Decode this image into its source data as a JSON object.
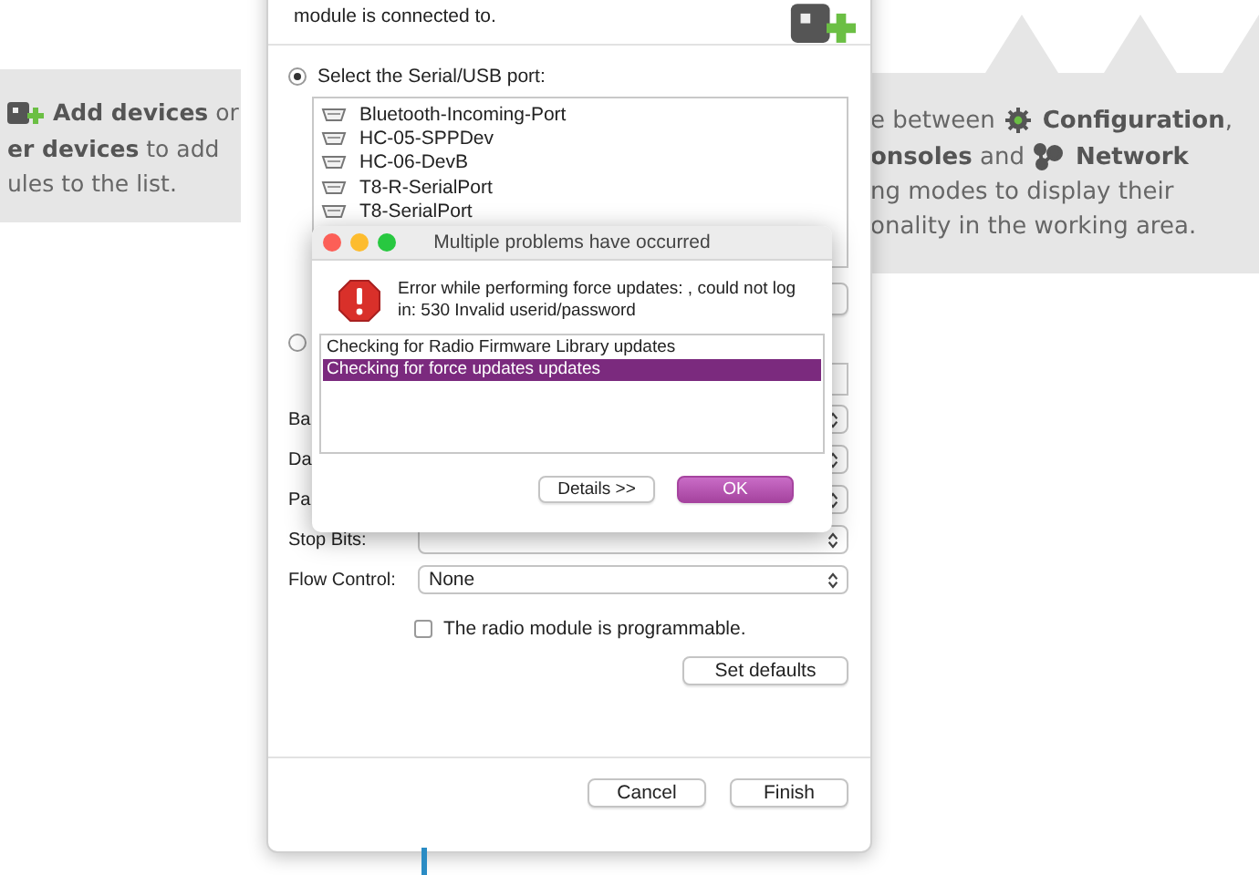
{
  "left_panel": {
    "lines": [
      {
        "text": "**Add devices** or"
      },
      {
        "text": "**er devices** to add"
      },
      {
        "text": "ules to the list."
      }
    ]
  },
  "right_panel": {
    "lines": [
      {
        "lead": "e between",
        "text": "**Configuration**,"
      },
      {
        "lead": "**onsoles** and",
        "text": "**Network**"
      },
      {
        "text": "ng modes to display their"
      },
      {
        "text": "onality in the working area."
      }
    ]
  },
  "wizard": {
    "description": "module is connected to.",
    "radios": [
      {
        "label": "Select the Serial/USB port:",
        "selected": true
      },
      {
        "selected": false
      }
    ],
    "ports": [
      "Bluetooth-Incoming-Port",
      "HC-05-SPPDev",
      "HC-06-DevB",
      "T8-R-SerialPort",
      "T8-SerialPort"
    ],
    "settings": [
      {
        "label": "Ba"
      },
      {
        "label": "Da"
      },
      {
        "label": "Pa"
      },
      {
        "label": "Stop Bits:"
      },
      {
        "label": "Flow Control:",
        "value": "None"
      }
    ],
    "programmable": {
      "label": "The radio module is programmable.",
      "checked": false
    },
    "defaults_button": "Set defaults",
    "buttons": [
      "Cancel",
      "Finish"
    ]
  },
  "dialog": {
    "title": "Multiple problems have occurred",
    "message": "Error while performing force updates: , could not log in: 530 Invalid userid/password",
    "items": [
      {
        "text": "Checking for Radio Firmware Library updates",
        "selected": false
      },
      {
        "text": "Checking for force updates updates",
        "selected": true
      }
    ],
    "details_button": "Details >>",
    "ok_button": "OK"
  }
}
